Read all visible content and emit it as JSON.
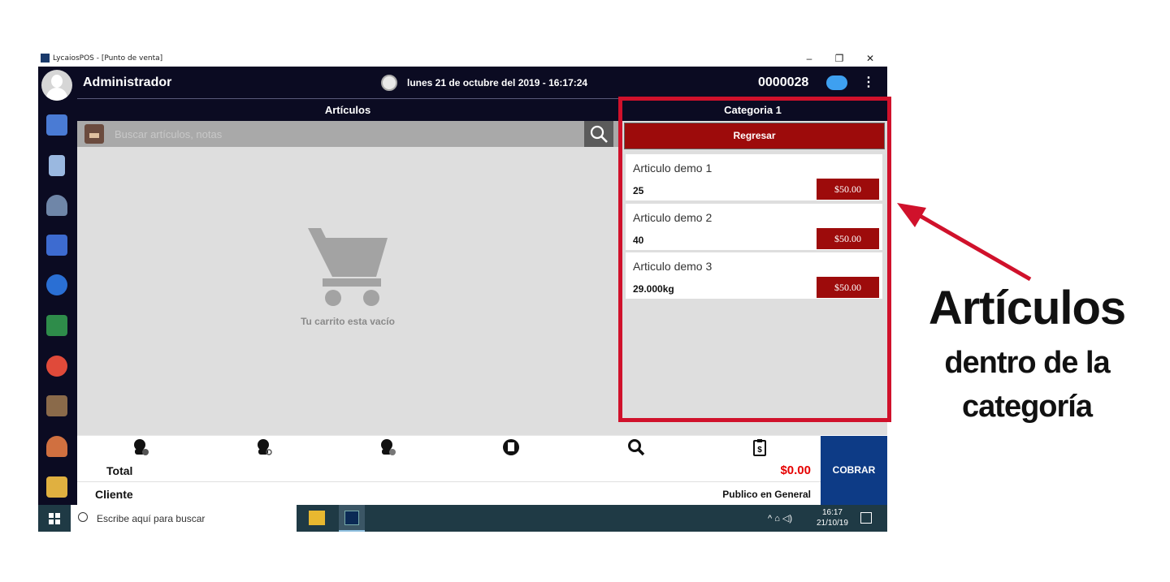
{
  "window": {
    "title": "LycaiosPOS - [Punto de venta]",
    "minimize": "–",
    "restore": "❐",
    "close": "✕"
  },
  "header": {
    "user": "Administrador",
    "datetime": "lunes 21 de octubre del 2019 - 16:17:24",
    "ticket": "0000028",
    "menu": "⋮"
  },
  "articles": {
    "title": "Artículos",
    "search_placeholder": "Buscar artículos, notas",
    "empty_cart": "Tu carrito esta vacío"
  },
  "category": {
    "title": "Categoria 1",
    "back_label": "Regresar",
    "items": [
      {
        "name": "Articulo demo 1",
        "qty": "25",
        "price": "$50.00"
      },
      {
        "name": "Articulo demo 2",
        "qty": "40",
        "price": "$50.00"
      },
      {
        "name": "Articulo demo 3",
        "qty": "29.000kg",
        "price": "$50.00"
      }
    ]
  },
  "sidebar": {
    "icons": [
      "sales-icon",
      "notebook-icon",
      "users-icon",
      "reports-icon",
      "top-icon",
      "money-icon",
      "alarm-icon",
      "inventory-icon",
      "team-icon",
      "cash-register-icon"
    ],
    "colors": [
      "#4a7bd4",
      "#9ab8e0",
      "#6f86a8",
      "#3d6bd0",
      "#2a6fd4",
      "#2e8c4a",
      "#e04a3a",
      "#8a6a4a",
      "#d07040",
      "#e0b040"
    ]
  },
  "actions": {
    "icons": [
      "add-customer-icon",
      "search-customer-icon",
      "remove-customer-icon",
      "add-note-icon",
      "search-icon",
      "clipboard-price-icon"
    ]
  },
  "totals": {
    "total_label": "Total",
    "total_value": "$0.00",
    "client_label": "Cliente",
    "client_value": "Publico en General",
    "charge_label": "COBRAR"
  },
  "taskbar": {
    "search_label": "Escribe aquí para buscar",
    "tray": "^ ⌂ ◁)",
    "time": "16:17",
    "date": "21/10/19"
  },
  "annotation": {
    "title": "Artículos",
    "line1": "dentro de la",
    "line2": "categoría",
    "color": "#d0112b"
  }
}
